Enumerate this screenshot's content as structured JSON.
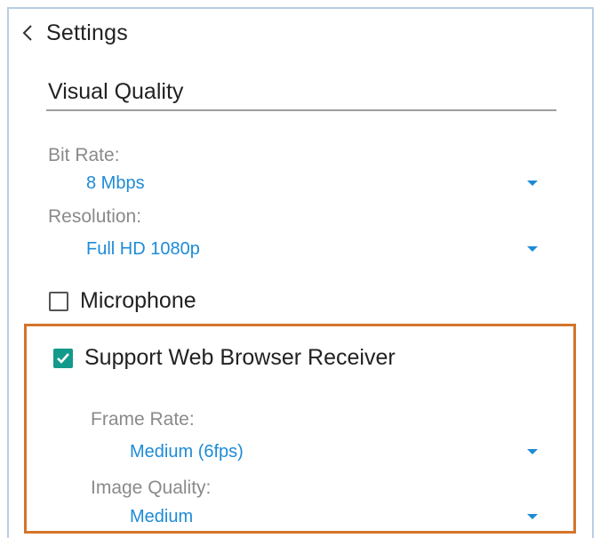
{
  "header": {
    "back_icon": "chevron-left-icon",
    "title": "Settings"
  },
  "visual_quality": {
    "title": "Visual Quality",
    "bit_rate": {
      "label": "Bit Rate:",
      "value": "8 Mbps"
    },
    "resolution": {
      "label": "Resolution:",
      "value": "Full HD 1080p"
    }
  },
  "microphone": {
    "label": "Microphone",
    "checked": false
  },
  "web_browser_receiver": {
    "label": "Support Web Browser Receiver",
    "checked": true,
    "frame_rate": {
      "label": "Frame Rate:",
      "value": "Medium (6fps)"
    },
    "image_quality": {
      "label": "Image Quality:",
      "value": "Medium"
    }
  },
  "colors": {
    "accent_blue": "#1e8bd6",
    "checkbox_teal": "#139a8a",
    "highlight_orange": "#d4742b",
    "label_gray": "#8a8a8a"
  }
}
